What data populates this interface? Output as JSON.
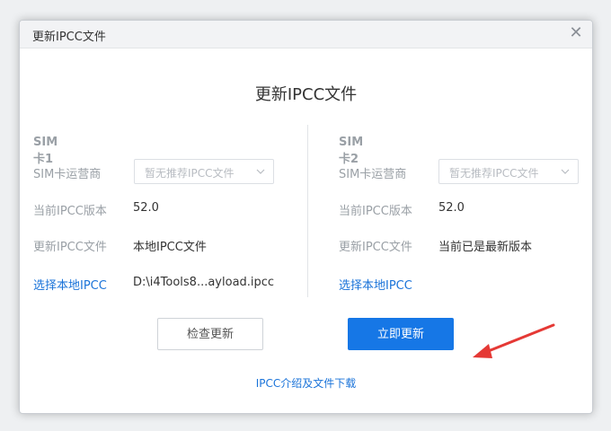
{
  "dialog": {
    "title": "更新IPCC文件",
    "heading": "更新IPCC文件",
    "close_glyph": "✕"
  },
  "sim1": {
    "title": "SIM卡1",
    "carrier_label": "SIM卡运营商",
    "carrier_select": "暂无推荐IPCC文件",
    "version_label": "当前IPCC版本",
    "version_value": "52.0",
    "update_label": "更新IPCC文件",
    "update_value": "本地IPCC文件",
    "local_link": "选择本地IPCC",
    "local_path": "D:\\i4Tools8...ayload.ipcc"
  },
  "sim2": {
    "title": "SIM卡2",
    "carrier_label": "SIM卡运营商",
    "carrier_select": "暂无推荐IPCC文件",
    "version_label": "当前IPCC版本",
    "version_value": "52.0",
    "update_label": "更新IPCC文件",
    "update_value": "当前已是最新版本",
    "local_link": "选择本地IPCC"
  },
  "buttons": {
    "check": "检查更新",
    "update_now": "立即更新"
  },
  "footer": {
    "link": "IPCC介绍及文件下载"
  },
  "colors": {
    "accent": "#1677e6",
    "link": "#1a73d9",
    "annotation_arrow": "#e53935"
  }
}
